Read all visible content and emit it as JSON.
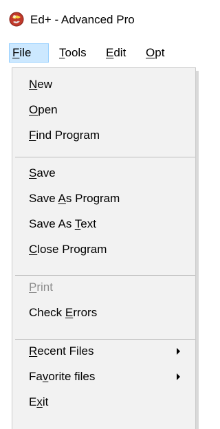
{
  "window": {
    "title": "Ed+ - Advanced Pro",
    "icon": "red-sphere-app-icon"
  },
  "menubar": {
    "items": [
      {
        "label": "File",
        "mnemonic_index": 0,
        "active": true
      },
      {
        "label": "Tools",
        "mnemonic_index": 0,
        "active": false
      },
      {
        "label": "Edit",
        "mnemonic_index": 0,
        "active": false
      },
      {
        "label": "Opt",
        "mnemonic_index": 0,
        "active": false
      }
    ]
  },
  "file_menu": {
    "groups": [
      [
        {
          "label": "New",
          "mnemonic_index": 0,
          "enabled": true
        },
        {
          "label": "Open",
          "mnemonic_index": 0,
          "enabled": true
        },
        {
          "label": "Find Program",
          "mnemonic_index": 0,
          "enabled": true
        }
      ],
      [
        {
          "label": "Save",
          "mnemonic_index": 0,
          "enabled": true
        },
        {
          "label": "Save As Program",
          "mnemonic_index": 5,
          "enabled": true
        },
        {
          "label": "Save As Text",
          "mnemonic_index": 8,
          "enabled": true
        },
        {
          "label": "Close Program",
          "mnemonic_index": 0,
          "enabled": true
        }
      ],
      [
        {
          "label": "Print",
          "mnemonic_index": 0,
          "enabled": false
        },
        {
          "label": "Check Errors",
          "mnemonic_index": 6,
          "enabled": true
        }
      ],
      [
        {
          "label": "Recent Files",
          "mnemonic_index": 0,
          "enabled": true,
          "submenu": true
        },
        {
          "label": "Favorite files",
          "mnemonic_index": 2,
          "enabled": true,
          "submenu": true
        },
        {
          "label": "Exit",
          "mnemonic_index": 1,
          "enabled": true
        }
      ]
    ]
  },
  "colors": {
    "menu_background": "#f2f2f2",
    "menubar_highlight": "#cce8ff",
    "disabled_text": "#8c8c8c"
  }
}
